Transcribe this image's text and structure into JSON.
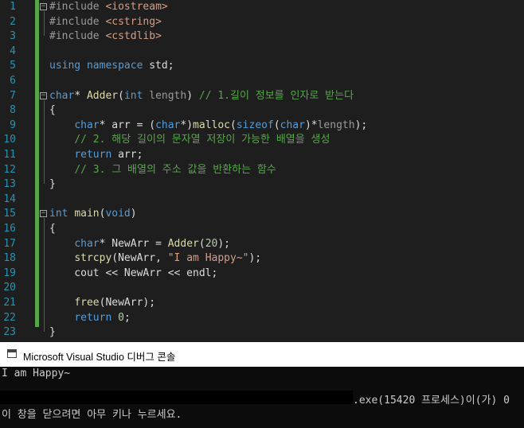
{
  "editor": {
    "lines": [
      {
        "n": "1",
        "fold": true,
        "tokens": [
          {
            "c": "pp",
            "t": "#include "
          },
          {
            "c": "inc",
            "t": "<iostream>"
          }
        ]
      },
      {
        "n": "2",
        "fold": false,
        "tokens": [
          {
            "c": "pp",
            "t": "#include "
          },
          {
            "c": "inc",
            "t": "<cstring>"
          }
        ]
      },
      {
        "n": "3",
        "fold": false,
        "tokens": [
          {
            "c": "pp",
            "t": "#include "
          },
          {
            "c": "inc",
            "t": "<cstdlib>"
          }
        ]
      },
      {
        "n": "4",
        "fold": false,
        "tokens": []
      },
      {
        "n": "5",
        "fold": false,
        "tokens": [
          {
            "c": "kw",
            "t": "using namespace"
          },
          {
            "c": "plain",
            "t": " std;"
          }
        ]
      },
      {
        "n": "6",
        "fold": false,
        "tokens": []
      },
      {
        "n": "7",
        "fold": true,
        "tokens": [
          {
            "c": "kw",
            "t": "char"
          },
          {
            "c": "plain",
            "t": "* "
          },
          {
            "c": "fn",
            "t": "Adder"
          },
          {
            "c": "plain",
            "t": "("
          },
          {
            "c": "kw",
            "t": "int"
          },
          {
            "c": "param",
            "t": " length"
          },
          {
            "c": "plain",
            "t": ") "
          },
          {
            "c": "cmt",
            "t": "// 1.길이 정보를 인자로 받는다"
          }
        ]
      },
      {
        "n": "8",
        "fold": false,
        "tokens": [
          {
            "c": "plain",
            "t": "{"
          }
        ]
      },
      {
        "n": "9",
        "fold": false,
        "tokens": [
          {
            "c": "plain",
            "t": "    "
          },
          {
            "c": "kw",
            "t": "char"
          },
          {
            "c": "plain",
            "t": "* arr = ("
          },
          {
            "c": "kw",
            "t": "char"
          },
          {
            "c": "plain",
            "t": "*)"
          },
          {
            "c": "fn",
            "t": "malloc"
          },
          {
            "c": "plain",
            "t": "("
          },
          {
            "c": "kw",
            "t": "sizeof"
          },
          {
            "c": "plain",
            "t": "("
          },
          {
            "c": "kw",
            "t": "char"
          },
          {
            "c": "plain",
            "t": ")*"
          },
          {
            "c": "param",
            "t": "length"
          },
          {
            "c": "plain",
            "t": ");"
          }
        ]
      },
      {
        "n": "10",
        "fold": false,
        "tokens": [
          {
            "c": "plain",
            "t": "    "
          },
          {
            "c": "cmt",
            "t": "// 2. 해당 길이의 문자열 저장이 가능한 배열을 생성"
          }
        ]
      },
      {
        "n": "11",
        "fold": false,
        "tokens": [
          {
            "c": "plain",
            "t": "    "
          },
          {
            "c": "kw",
            "t": "return"
          },
          {
            "c": "plain",
            "t": " arr;"
          }
        ]
      },
      {
        "n": "12",
        "fold": false,
        "tokens": [
          {
            "c": "plain",
            "t": "    "
          },
          {
            "c": "cmt",
            "t": "// 3. 그 배열의 주소 값을 반환하는 함수"
          }
        ]
      },
      {
        "n": "13",
        "fold": false,
        "tokens": [
          {
            "c": "plain",
            "t": "}"
          }
        ]
      },
      {
        "n": "14",
        "fold": false,
        "tokens": []
      },
      {
        "n": "15",
        "fold": true,
        "tokens": [
          {
            "c": "kw",
            "t": "int"
          },
          {
            "c": "plain",
            "t": " "
          },
          {
            "c": "fn",
            "t": "main"
          },
          {
            "c": "plain",
            "t": "("
          },
          {
            "c": "kw",
            "t": "void"
          },
          {
            "c": "plain",
            "t": ")"
          }
        ]
      },
      {
        "n": "16",
        "fold": false,
        "tokens": [
          {
            "c": "plain",
            "t": "{"
          }
        ]
      },
      {
        "n": "17",
        "fold": false,
        "tokens": [
          {
            "c": "plain",
            "t": "    "
          },
          {
            "c": "kw",
            "t": "char"
          },
          {
            "c": "plain",
            "t": "* NewArr = "
          },
          {
            "c": "fn",
            "t": "Adder"
          },
          {
            "c": "plain",
            "t": "("
          },
          {
            "c": "num",
            "t": "20"
          },
          {
            "c": "plain",
            "t": ");"
          }
        ]
      },
      {
        "n": "18",
        "fold": false,
        "tokens": [
          {
            "c": "plain",
            "t": "    "
          },
          {
            "c": "fn",
            "t": "strcpy"
          },
          {
            "c": "plain",
            "t": "(NewArr, "
          },
          {
            "c": "str",
            "t": "\"I am Happy~\""
          },
          {
            "c": "plain",
            "t": ");"
          }
        ]
      },
      {
        "n": "19",
        "fold": false,
        "tokens": [
          {
            "c": "plain",
            "t": "    cout << NewArr << endl;"
          }
        ]
      },
      {
        "n": "20",
        "fold": false,
        "tokens": []
      },
      {
        "n": "21",
        "fold": false,
        "tokens": [
          {
            "c": "plain",
            "t": "    "
          },
          {
            "c": "fn",
            "t": "free"
          },
          {
            "c": "plain",
            "t": "(NewArr);"
          }
        ]
      },
      {
        "n": "22",
        "fold": false,
        "tokens": [
          {
            "c": "plain",
            "t": "    "
          },
          {
            "c": "kw",
            "t": "return"
          },
          {
            "c": "plain",
            "t": " "
          },
          {
            "c": "num",
            "t": "0"
          },
          {
            "c": "plain",
            "t": ";"
          }
        ]
      },
      {
        "n": "23",
        "fold": false,
        "tokens": [
          {
            "c": "plain",
            "t": "}"
          }
        ]
      }
    ]
  },
  "console": {
    "title": "Microsoft Visual Studio 디버그 콘솔",
    "output_line": "I am Happy~",
    "exit_text": ".exe(15420 프로세스)이(가) 0",
    "prompt_line": "이 창을 닫으려면 아무 키나 누르세요."
  },
  "colors": {
    "editor_bg": "#1e1e1e",
    "keyword": "#569cd6",
    "comment": "#57a64a",
    "string": "#d69d85",
    "line_number": "#2b91af",
    "console_bg": "#0c0c0c"
  }
}
